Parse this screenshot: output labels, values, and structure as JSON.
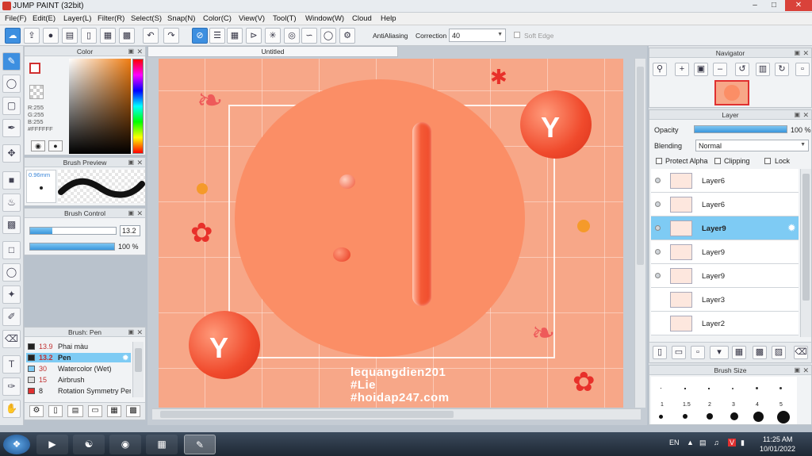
{
  "app": {
    "title": "JUMP PAINT (32bit)"
  },
  "menu": [
    "File(F)",
    "Edit(E)",
    "Layer(L)",
    "Filter(R)",
    "Select(S)",
    "Snap(N)",
    "Color(C)",
    "View(V)",
    "Tool(T)",
    "Window(W)",
    "Cloud",
    "Help"
  ],
  "toolbar": {
    "antialiasing_label": "AntiAliasing",
    "correction_label": "Correction",
    "correction_value": "40",
    "soft_edge_label": "Soft Edge"
  },
  "color_panel": {
    "title": "Color",
    "r": "R:255",
    "g": "G:255",
    "b": "B:255",
    "hex": "#FFFFFF"
  },
  "brush_preview": {
    "title": "Brush Preview",
    "size": "0.96mm"
  },
  "brush_control": {
    "title": "Brush Control",
    "size": "13.2",
    "opacity": "100 %",
    "opacity_fraction": 1.0
  },
  "brush_list": {
    "title": "Brush: Pen",
    "items": [
      {
        "size": "13.9",
        "name": "Phai màu",
        "swatch": "#222222"
      },
      {
        "size": "13.2",
        "name": "Pen",
        "swatch": "#222222",
        "selected": true
      },
      {
        "size": "30",
        "name": "Watercolor (Wet)",
        "swatch": "#7ecbf4"
      },
      {
        "size": "15",
        "name": "Airbrush",
        "swatch": "#dddddd"
      },
      {
        "size": "8",
        "name": "Rotation Symmetry Pen",
        "swatch": "#e03030"
      }
    ]
  },
  "document": {
    "tab": "Untitled"
  },
  "canvas_text": {
    "line1": "lequangdien201",
    "line2": "#Lie",
    "line3": "#hoidap247.com"
  },
  "navigator": {
    "title": "Navigator"
  },
  "layer_panel": {
    "title": "Layer",
    "opacity_label": "Opacity",
    "opacity_value": "100 %",
    "blending_label": "Blending",
    "blending_value": "Normal",
    "protect_alpha": "Protect Alpha",
    "clipping": "Clipping",
    "lock": "Lock",
    "layers": [
      {
        "name": "Layer6",
        "selected": false
      },
      {
        "name": "Layer6",
        "selected": false
      },
      {
        "name": "Layer9",
        "selected": true
      },
      {
        "name": "Layer9",
        "selected": false
      },
      {
        "name": "Layer9",
        "selected": false
      },
      {
        "name": "Layer3",
        "selected": false
      },
      {
        "name": "Layer2",
        "selected": false
      }
    ]
  },
  "brush_size": {
    "title": "Brush Size",
    "labels": [
      "1",
      "1.5",
      "2",
      "3",
      "4",
      "5"
    ]
  },
  "taskbar": {
    "lang": "EN",
    "time": "11:25 AM",
    "date": "10/01/2022"
  },
  "colors": {
    "accent": "#3d8fe0",
    "canvas_bg": "#f7a788",
    "circle": "#fb8e66",
    "ball": "#f04a2c"
  },
  "icons": [
    "brush-icon",
    "eraser-icon",
    "select-rect-icon",
    "move-icon",
    "fill-icon",
    "text-icon",
    "undo-icon",
    "redo-icon",
    "zoom-in-icon",
    "zoom-out-icon",
    "close-icon",
    "trash-icon"
  ]
}
